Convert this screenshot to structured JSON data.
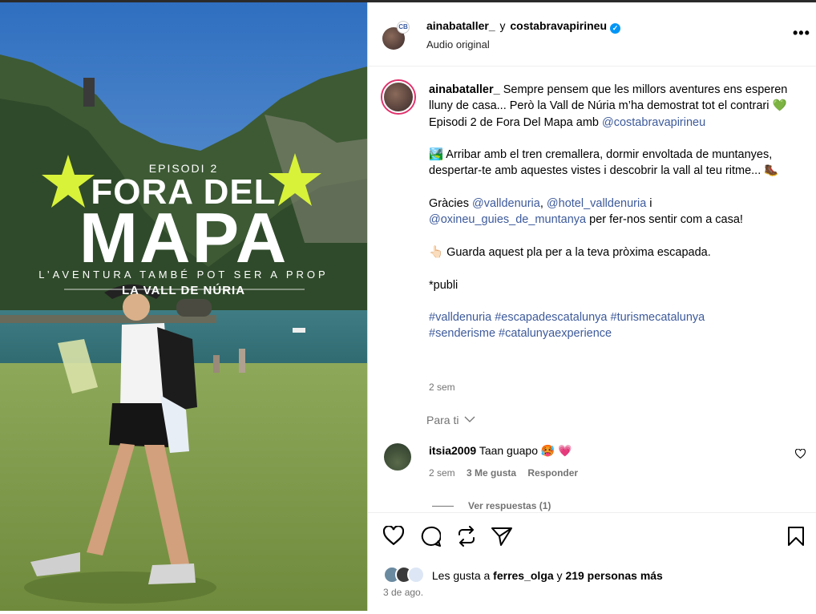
{
  "post": {
    "header": {
      "author": "ainabataller_",
      "joiner": "y",
      "coauthor": "costabravapirineu",
      "verified_glyph": "✓",
      "audio": "Audio original",
      "more_glyph": "•••",
      "coauthor_badge": "CB"
    },
    "media": {
      "episode": "EPISODI 2",
      "title_top": "FORA DEL",
      "title_main": "MAPA",
      "tagline": "L’AVENTURA TAMBÉ POT SER A PROP",
      "location": "LA VALL DE NÚRIA"
    },
    "caption": {
      "author": "ainabataller_",
      "line1": "Sempre pensem que les millors aventures ens esperen lluny de casa... Però la Vall de Núria m’ha demostrat tot el contrari 💚",
      "line2_pre": "Episodi 2 de Fora Del Mapa amb ",
      "line2_mention": "@costabravapirineu",
      "line3": "🏞️ Arribar amb el tren cremallera, dormir envoltada de muntanyes, despertar-te amb aquestes vistes i descobrir la vall al teu ritme... 🥾",
      "thanks_pre": "Gràcies ",
      "thanks_m1": "@valldenuria",
      "thanks_sep": ", ",
      "thanks_m2": "@hotel_valldenuria",
      "thanks_and": " i ",
      "thanks_m3": "@oxineu_guies_de_muntanya",
      "thanks_post": " per fer-nos sentir com a casa!",
      "save": "👆🏻 Guarda aquest pla per a la teva pròxima escapada.",
      "publi": "*publi",
      "hashtags_line1": "#valldenuria #escapadescatalunya #turismecatalunya",
      "hashtags_line2": "#senderisme #catalunyaexperience",
      "time": "2 sem"
    },
    "para_ti": "Para ti",
    "comment": {
      "user": "itsia2009",
      "text": "Taan guapo 🥵 💗",
      "time": "2 sem",
      "likes": "3 Me gusta",
      "reply": "Responder",
      "view_replies": "Ver respuestas (1)"
    },
    "likes": {
      "prefix": "Les gusta a",
      "user": "ferres_olga",
      "joiner": "y",
      "others": "219 personas más"
    },
    "date": "3 de ago."
  },
  "colors": {
    "accent_link": "#3d5a9b",
    "verified": "#0095f6",
    "star": "#d8f23a",
    "muted": "#737373"
  },
  "icons": [
    "more-options-icon",
    "heart-icon",
    "comment-icon",
    "repost-icon",
    "share-icon",
    "save-icon",
    "chevron-down-icon",
    "verified-icon"
  ]
}
